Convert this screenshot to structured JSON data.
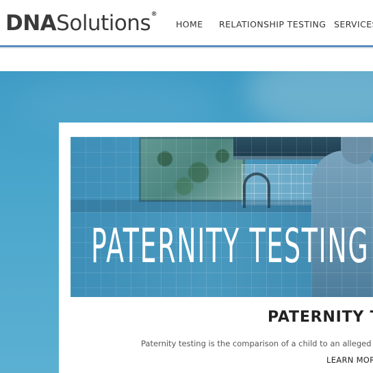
{
  "header": {
    "logo": {
      "bold": "DNA",
      "light": "Solutions",
      "mark": "®"
    },
    "nav": [
      {
        "label": "HOME"
      },
      {
        "label": "RELATIONSHIP TESTING"
      },
      {
        "label": "SERVICES"
      }
    ],
    "accent_color": "#5a8fc2"
  },
  "hero": {
    "background_color": "#4ba6cc",
    "banner_title": "PATERNITY TESTING",
    "card": {
      "heading": "PATERNITY T",
      "text": "Paternity testing is the comparison of a child to an alleged father to",
      "link_label": "LEARN MORE"
    }
  }
}
